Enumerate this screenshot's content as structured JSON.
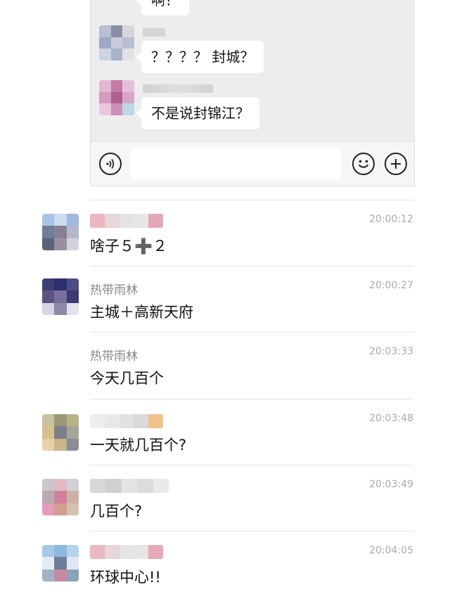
{
  "embedded_chat": {
    "messages": [
      {
        "text": "啊？"
      },
      {
        "text": "？？？？ 封城？"
      },
      {
        "text": "不是说封锦江？"
      }
    ]
  },
  "chat": {
    "rows": [
      {
        "sender": "",
        "time": "20:00:12",
        "text": "啥子５➕２"
      },
      {
        "sender": "热带雨林",
        "time": "20:00:27",
        "text": "主城＋高新天府"
      },
      {
        "sender": "热带雨林",
        "time": "20:03:33",
        "text": "今天几百个"
      },
      {
        "sender": "",
        "time": "20:03:48",
        "text": "一天就几百个?"
      },
      {
        "sender": "",
        "time": "20:03:49",
        "text": "几百个?"
      },
      {
        "sender": "",
        "time": "20:04:05",
        "text": "环球中心!!"
      }
    ]
  },
  "icons": {
    "voice": "voice-icon",
    "emoji": "emoji-icon",
    "plus": "plus-icon"
  }
}
